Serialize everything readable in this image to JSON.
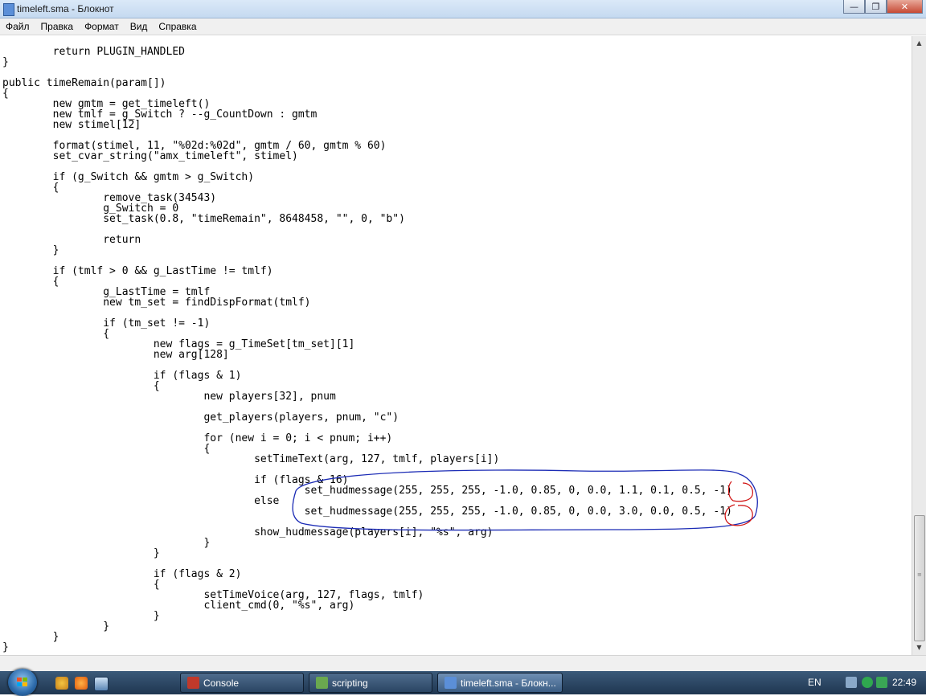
{
  "window": {
    "title": "timeleft.sma - Блокнот",
    "minimize_glyph": "—",
    "maximize_glyph": "❐",
    "close_glyph": "✕"
  },
  "menu": [
    "Файл",
    "Правка",
    "Формат",
    "Вид",
    "Справка"
  ],
  "editor": {
    "lines": [
      "        return PLUGIN_HANDLED",
      "}",
      "",
      "public timeRemain(param[])",
      "{",
      "        new gmtm = get_timeleft()",
      "        new tmlf = g_Switch ? --g_CountDown : gmtm",
      "        new stimel[12]",
      "",
      "        format(stimel, 11, \"%02d:%02d\", gmtm / 60, gmtm % 60)",
      "        set_cvar_string(\"amx_timeleft\", stimel)",
      "",
      "        if (g_Switch && gmtm > g_Switch)",
      "        {",
      "                remove_task(34543)",
      "                g_Switch = 0",
      "                set_task(0.8, \"timeRemain\", 8648458, \"\", 0, \"b\")",
      "",
      "                return",
      "        }",
      "",
      "        if (tmlf > 0 && g_LastTime != tmlf)",
      "        {",
      "                g_LastTime = tmlf",
      "                new tm_set = findDispFormat(tmlf)",
      "",
      "                if (tm_set != -1)",
      "                {",
      "                        new flags = g_TimeSet[tm_set][1]",
      "                        new arg[128]",
      "",
      "                        if (flags & 1)",
      "                        {",
      "                                new players[32], pnum",
      "",
      "                                get_players(players, pnum, \"c\")",
      "",
      "                                for (new i = 0; i < pnum; i++)",
      "                                {",
      "                                        setTimeText(arg, 127, tmlf, players[i])",
      "",
      "                                        if (flags & 16)",
      "                                                set_hudmessage(255, 255, 255, -1.0, 0.85, 0, 0.0, 1.1, 0.1, 0.5, -1)",
      "                                        else",
      "                                                set_hudmessage(255, 255, 255, -1.0, 0.85, 0, 0.0, 3.0, 0.0, 0.5, -1)",
      "",
      "                                        show_hudmessage(players[i], \"%s\", arg)",
      "                                }",
      "                        }",
      "",
      "                        if (flags & 2)",
      "                        {",
      "                                setTimeVoice(arg, 127, flags, tmlf)",
      "                                client_cmd(0, \"%s\", arg)",
      "                        }",
      "                }",
      "        }",
      "}"
    ]
  },
  "taskbar": {
    "tasks": [
      {
        "label": "Console",
        "icon": "console-icon",
        "color": "#c0392b"
      },
      {
        "label": "scripting",
        "icon": "folder-icon",
        "color": "#6aa84f"
      },
      {
        "label": "timeleft.sma - Блокн...",
        "icon": "notepad-icon",
        "color": "#5b8fd8"
      }
    ],
    "language": "EN",
    "clock": "22:49"
  },
  "annotation_colors": {
    "blue": "#1b2bb5",
    "red": "#d01010"
  }
}
